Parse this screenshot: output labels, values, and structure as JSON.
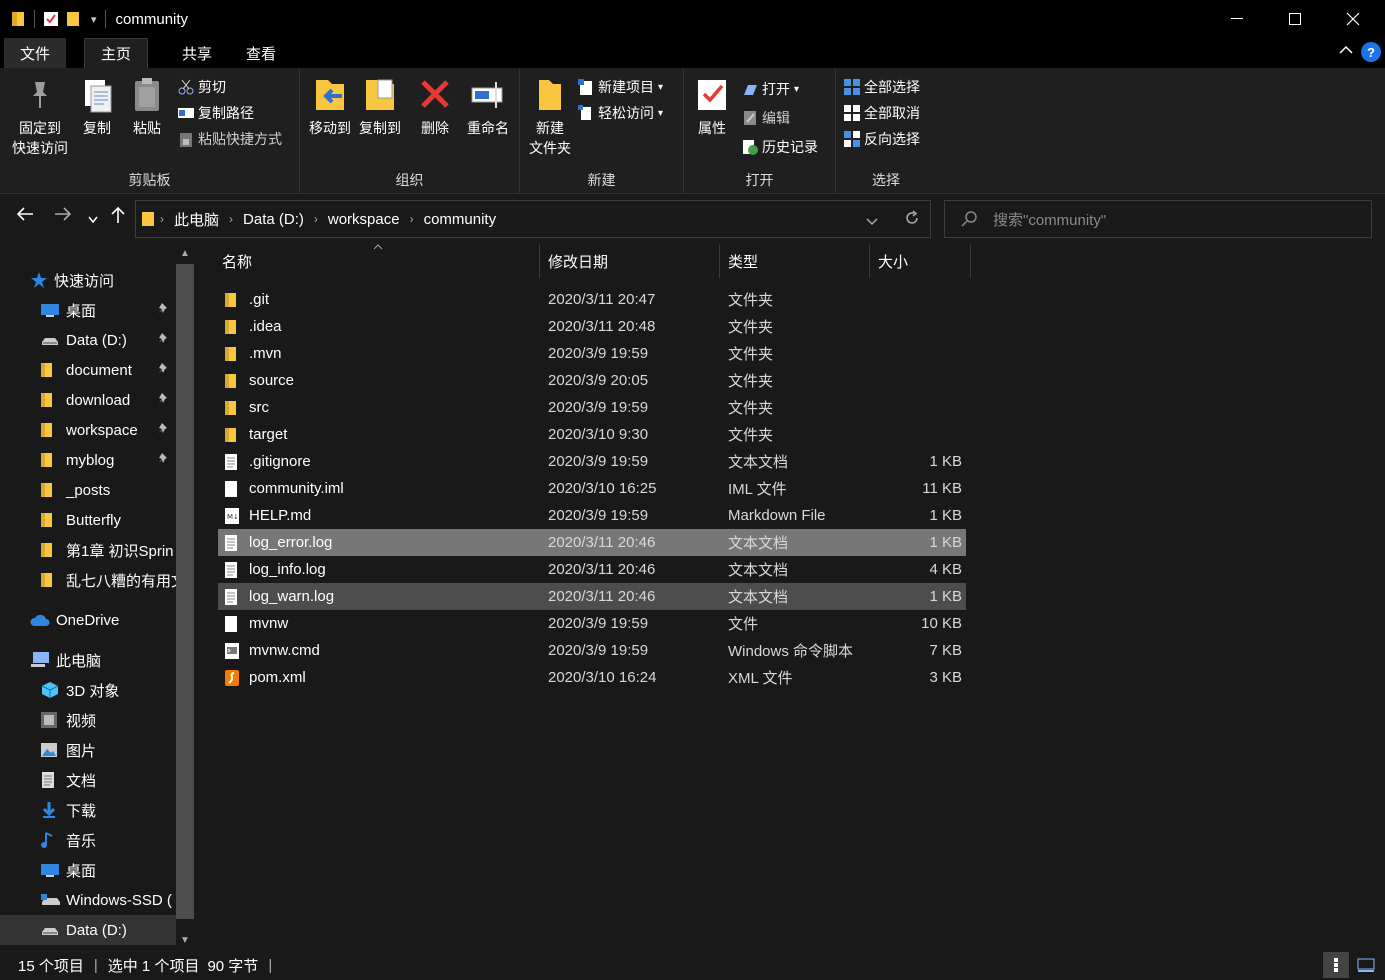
{
  "window": {
    "title": "community",
    "qat_dropdown": "▾"
  },
  "tabs": {
    "file": "文件",
    "home": "主页",
    "share": "共享",
    "view": "查看",
    "help": "?"
  },
  "ribbon": {
    "clipboard": {
      "label": "剪贴板",
      "pin_line1": "固定到",
      "pin_line2": "快速访问",
      "copy": "复制",
      "paste": "粘贴",
      "cut": "剪切",
      "copy_path": "复制路径",
      "paste_shortcut": "粘贴快捷方式"
    },
    "organize": {
      "label": "组织",
      "move_to": "移动到",
      "copy_to": "复制到",
      "delete": "删除",
      "rename": "重命名"
    },
    "new": {
      "label": "新建",
      "new_folder_line1": "新建",
      "new_folder_line2": "文件夹",
      "new_item": "新建项目",
      "easy_access": "轻松访问"
    },
    "open": {
      "label": "打开",
      "properties": "属性",
      "open": "打开",
      "edit": "编辑",
      "history": "历史记录"
    },
    "select": {
      "label": "选择",
      "select_all": "全部选择",
      "select_none": "全部取消",
      "invert": "反向选择"
    }
  },
  "address": {
    "crumbs": [
      "此电脑",
      "Data (D:)",
      "workspace",
      "community"
    ],
    "search_placeholder": "搜索\"community\""
  },
  "navpane": {
    "quick_access": "快速访问",
    "items": [
      {
        "label": "桌面",
        "icon": "desktop-icon",
        "pinned": true
      },
      {
        "label": "Data (D:)",
        "icon": "drive-icon",
        "pinned": true
      },
      {
        "label": "document",
        "icon": "folder-icon",
        "pinned": true
      },
      {
        "label": "download",
        "icon": "folder-icon",
        "pinned": true
      },
      {
        "label": "workspace",
        "icon": "folder-icon",
        "pinned": true
      },
      {
        "label": "myblog",
        "icon": "folder-icon",
        "pinned": true
      },
      {
        "label": "_posts",
        "icon": "folder-icon",
        "pinned": false
      },
      {
        "label": "Butterfly",
        "icon": "folder-icon",
        "pinned": false
      },
      {
        "label": "第1章 初识Sprin",
        "icon": "folder-icon",
        "pinned": false
      },
      {
        "label": "乱七八糟的有用文",
        "icon": "folder-icon",
        "pinned": false
      }
    ],
    "onedrive": "OneDrive",
    "this_pc": "此电脑",
    "pc_items": [
      {
        "label": "3D 对象",
        "icon": "3d-objects-icon"
      },
      {
        "label": "视频",
        "icon": "video-icon"
      },
      {
        "label": "图片",
        "icon": "pictures-icon"
      },
      {
        "label": "文档",
        "icon": "documents-icon"
      },
      {
        "label": "下载",
        "icon": "download-icon"
      },
      {
        "label": "音乐",
        "icon": "music-icon"
      },
      {
        "label": "桌面",
        "icon": "desktop-icon"
      },
      {
        "label": "Windows-SSD (",
        "icon": "system-drive-icon"
      },
      {
        "label": "Data (D:)",
        "icon": "drive-icon"
      }
    ]
  },
  "columns": {
    "name": "名称",
    "date": "修改日期",
    "type": "类型",
    "size": "大小"
  },
  "files": [
    {
      "name": ".git",
      "date": "2020/3/11 20:47",
      "type": "文件夹",
      "size": "",
      "icon": "folder-icon",
      "state": ""
    },
    {
      "name": ".idea",
      "date": "2020/3/11 20:48",
      "type": "文件夹",
      "size": "",
      "icon": "folder-icon",
      "state": ""
    },
    {
      "name": ".mvn",
      "date": "2020/3/9 19:59",
      "type": "文件夹",
      "size": "",
      "icon": "folder-icon",
      "state": ""
    },
    {
      "name": "source",
      "date": "2020/3/9 20:05",
      "type": "文件夹",
      "size": "",
      "icon": "folder-icon",
      "state": ""
    },
    {
      "name": "src",
      "date": "2020/3/9 19:59",
      "type": "文件夹",
      "size": "",
      "icon": "folder-icon",
      "state": ""
    },
    {
      "name": "target",
      "date": "2020/3/10 9:30",
      "type": "文件夹",
      "size": "",
      "icon": "folder-icon",
      "state": ""
    },
    {
      "name": ".gitignore",
      "date": "2020/3/9 19:59",
      "type": "文本文档",
      "size": "1 KB",
      "icon": "text-file-icon",
      "state": ""
    },
    {
      "name": "community.iml",
      "date": "2020/3/10 16:25",
      "type": "IML 文件",
      "size": "11 KB",
      "icon": "blank-file-icon",
      "state": ""
    },
    {
      "name": "HELP.md",
      "date": "2020/3/9 19:59",
      "type": "Markdown File",
      "size": "1 KB",
      "icon": "markdown-file-icon",
      "state": ""
    },
    {
      "name": "log_error.log",
      "date": "2020/3/11 20:46",
      "type": "文本文档",
      "size": "1 KB",
      "icon": "text-file-icon",
      "state": "selected"
    },
    {
      "name": "log_info.log",
      "date": "2020/3/11 20:46",
      "type": "文本文档",
      "size": "4 KB",
      "icon": "text-file-icon",
      "state": ""
    },
    {
      "name": "log_warn.log",
      "date": "2020/3/11 20:46",
      "type": "文本文档",
      "size": "1 KB",
      "icon": "text-file-icon",
      "state": "hover"
    },
    {
      "name": "mvnw",
      "date": "2020/3/9 19:59",
      "type": "文件",
      "size": "10 KB",
      "icon": "blank-file-icon",
      "state": ""
    },
    {
      "name": "mvnw.cmd",
      "date": "2020/3/9 19:59",
      "type": "Windows 命令脚本",
      "size": "7 KB",
      "icon": "cmd-file-icon",
      "state": ""
    },
    {
      "name": "pom.xml",
      "date": "2020/3/10 16:24",
      "type": "XML 文件",
      "size": "3 KB",
      "icon": "xml-file-icon",
      "state": ""
    }
  ],
  "status": {
    "count": "15 个项目",
    "selection": "选中 1 个项目",
    "size": "90 字节"
  },
  "colors": {
    "background": "#191919",
    "selection": "#777777",
    "hover": "#4d4d4d",
    "folder": "#f8c640",
    "accent": "#1a73e8"
  }
}
